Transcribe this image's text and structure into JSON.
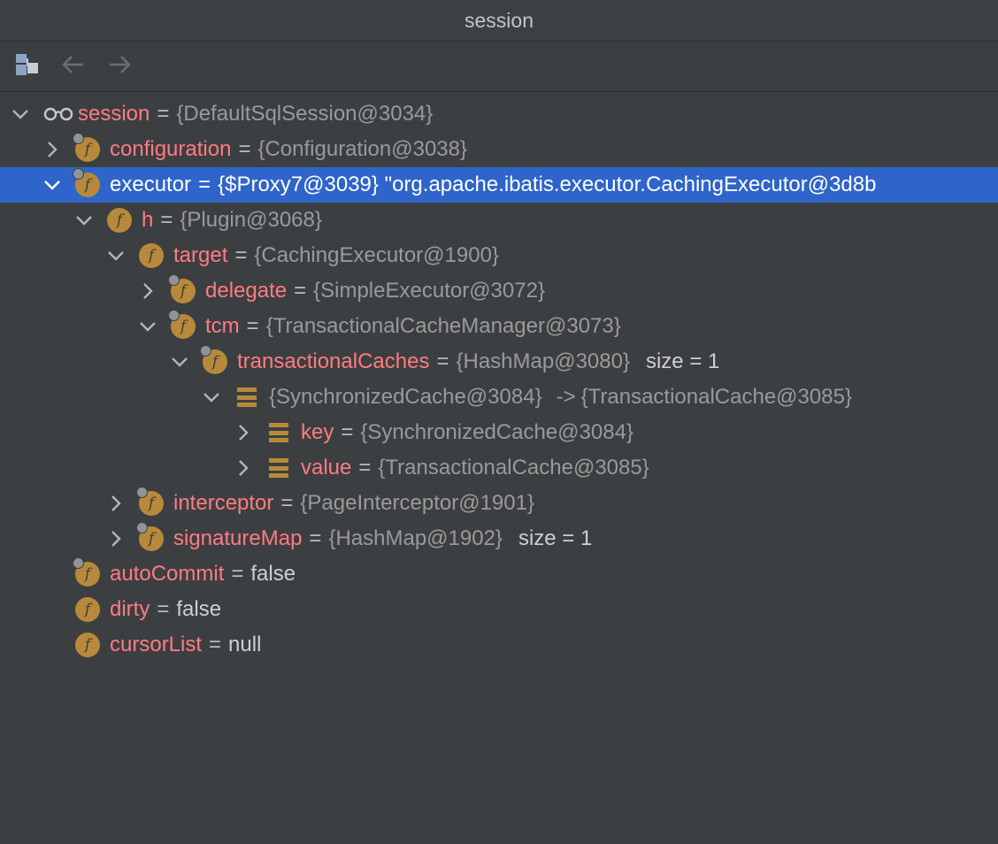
{
  "window": {
    "title": "session"
  },
  "toolbar": [
    {
      "icon": "show-objects-icon"
    },
    {
      "icon": "back-arrow-icon"
    },
    {
      "icon": "forward-arrow-icon"
    }
  ],
  "tree": [
    {
      "level": 0,
      "expand": "expanded",
      "icon": "watch-glasses-icon",
      "name": "session",
      "value": "{DefaultSqlSession@3034}",
      "valueStyle": "ref"
    },
    {
      "level": 1,
      "expand": "collapsed",
      "icon": "field-icon",
      "pinned": true,
      "name": "configuration",
      "value": "{Configuration@3038}",
      "valueStyle": "ref"
    },
    {
      "level": 1,
      "expand": "expanded",
      "icon": "field-icon",
      "pinned": true,
      "selected": true,
      "name": "executor",
      "value": "{$Proxy7@3039} \"org.apache.ibatis.executor.CachingExecutor@3d8b",
      "valueStyle": "ref"
    },
    {
      "level": 2,
      "expand": "expanded",
      "icon": "field-icon",
      "name": "h",
      "value": "{Plugin@3068}",
      "valueStyle": "ref"
    },
    {
      "level": 3,
      "expand": "expanded",
      "icon": "field-icon",
      "name": "target",
      "value": "{CachingExecutor@1900}",
      "valueStyle": "ref"
    },
    {
      "level": 4,
      "expand": "collapsed",
      "icon": "field-icon",
      "pinned": true,
      "name": "delegate",
      "value": "{SimpleExecutor@3072}",
      "valueStyle": "ref"
    },
    {
      "level": 4,
      "expand": "expanded",
      "icon": "field-icon",
      "pinned": true,
      "name": "tcm",
      "value": "{TransactionalCacheManager@3073}",
      "valueStyle": "ref"
    },
    {
      "level": 5,
      "expand": "expanded",
      "icon": "field-icon",
      "pinned": true,
      "name": "transactionalCaches",
      "value": "{HashMap@3080}",
      "valueStyle": "ref",
      "extra": "size = 1"
    },
    {
      "level": 6,
      "expand": "expanded",
      "icon": "map-entry-icon",
      "name": "",
      "value": "{SynchronizedCache@3084}",
      "valueStyle": "ref",
      "arrow": "->",
      "target": "{TransactionalCache@3085}"
    },
    {
      "level": 7,
      "expand": "collapsed",
      "icon": "map-entry-icon",
      "name": "key",
      "value": "{SynchronizedCache@3084}",
      "valueStyle": "ref"
    },
    {
      "level": 7,
      "expand": "collapsed",
      "icon": "map-entry-icon",
      "name": "value",
      "value": "{TransactionalCache@3085}",
      "valueStyle": "ref"
    },
    {
      "level": 3,
      "expand": "collapsed",
      "icon": "field-icon",
      "pinned": true,
      "name": "interceptor",
      "value": "{PageInterceptor@1901}",
      "valueStyle": "ref"
    },
    {
      "level": 3,
      "expand": "collapsed",
      "icon": "field-icon",
      "pinned": true,
      "name": "signatureMap",
      "value": "{HashMap@1902}",
      "valueStyle": "ref",
      "extra": "size = 1"
    },
    {
      "level": 1,
      "expand": "none",
      "icon": "field-icon",
      "pinned": true,
      "name": "autoCommit",
      "value": "false",
      "valueStyle": "plain"
    },
    {
      "level": 1,
      "expand": "none",
      "icon": "field-icon",
      "name": "dirty",
      "value": "false",
      "valueStyle": "plain"
    },
    {
      "level": 1,
      "expand": "none",
      "icon": "field-icon",
      "name": "cursorList",
      "value": "null",
      "valueStyle": "plain"
    }
  ],
  "colors": {
    "background": "#3c3f41",
    "selection": "#2f65ca",
    "fieldName": "#ff7b82",
    "fieldIcon": "#b8893a"
  }
}
